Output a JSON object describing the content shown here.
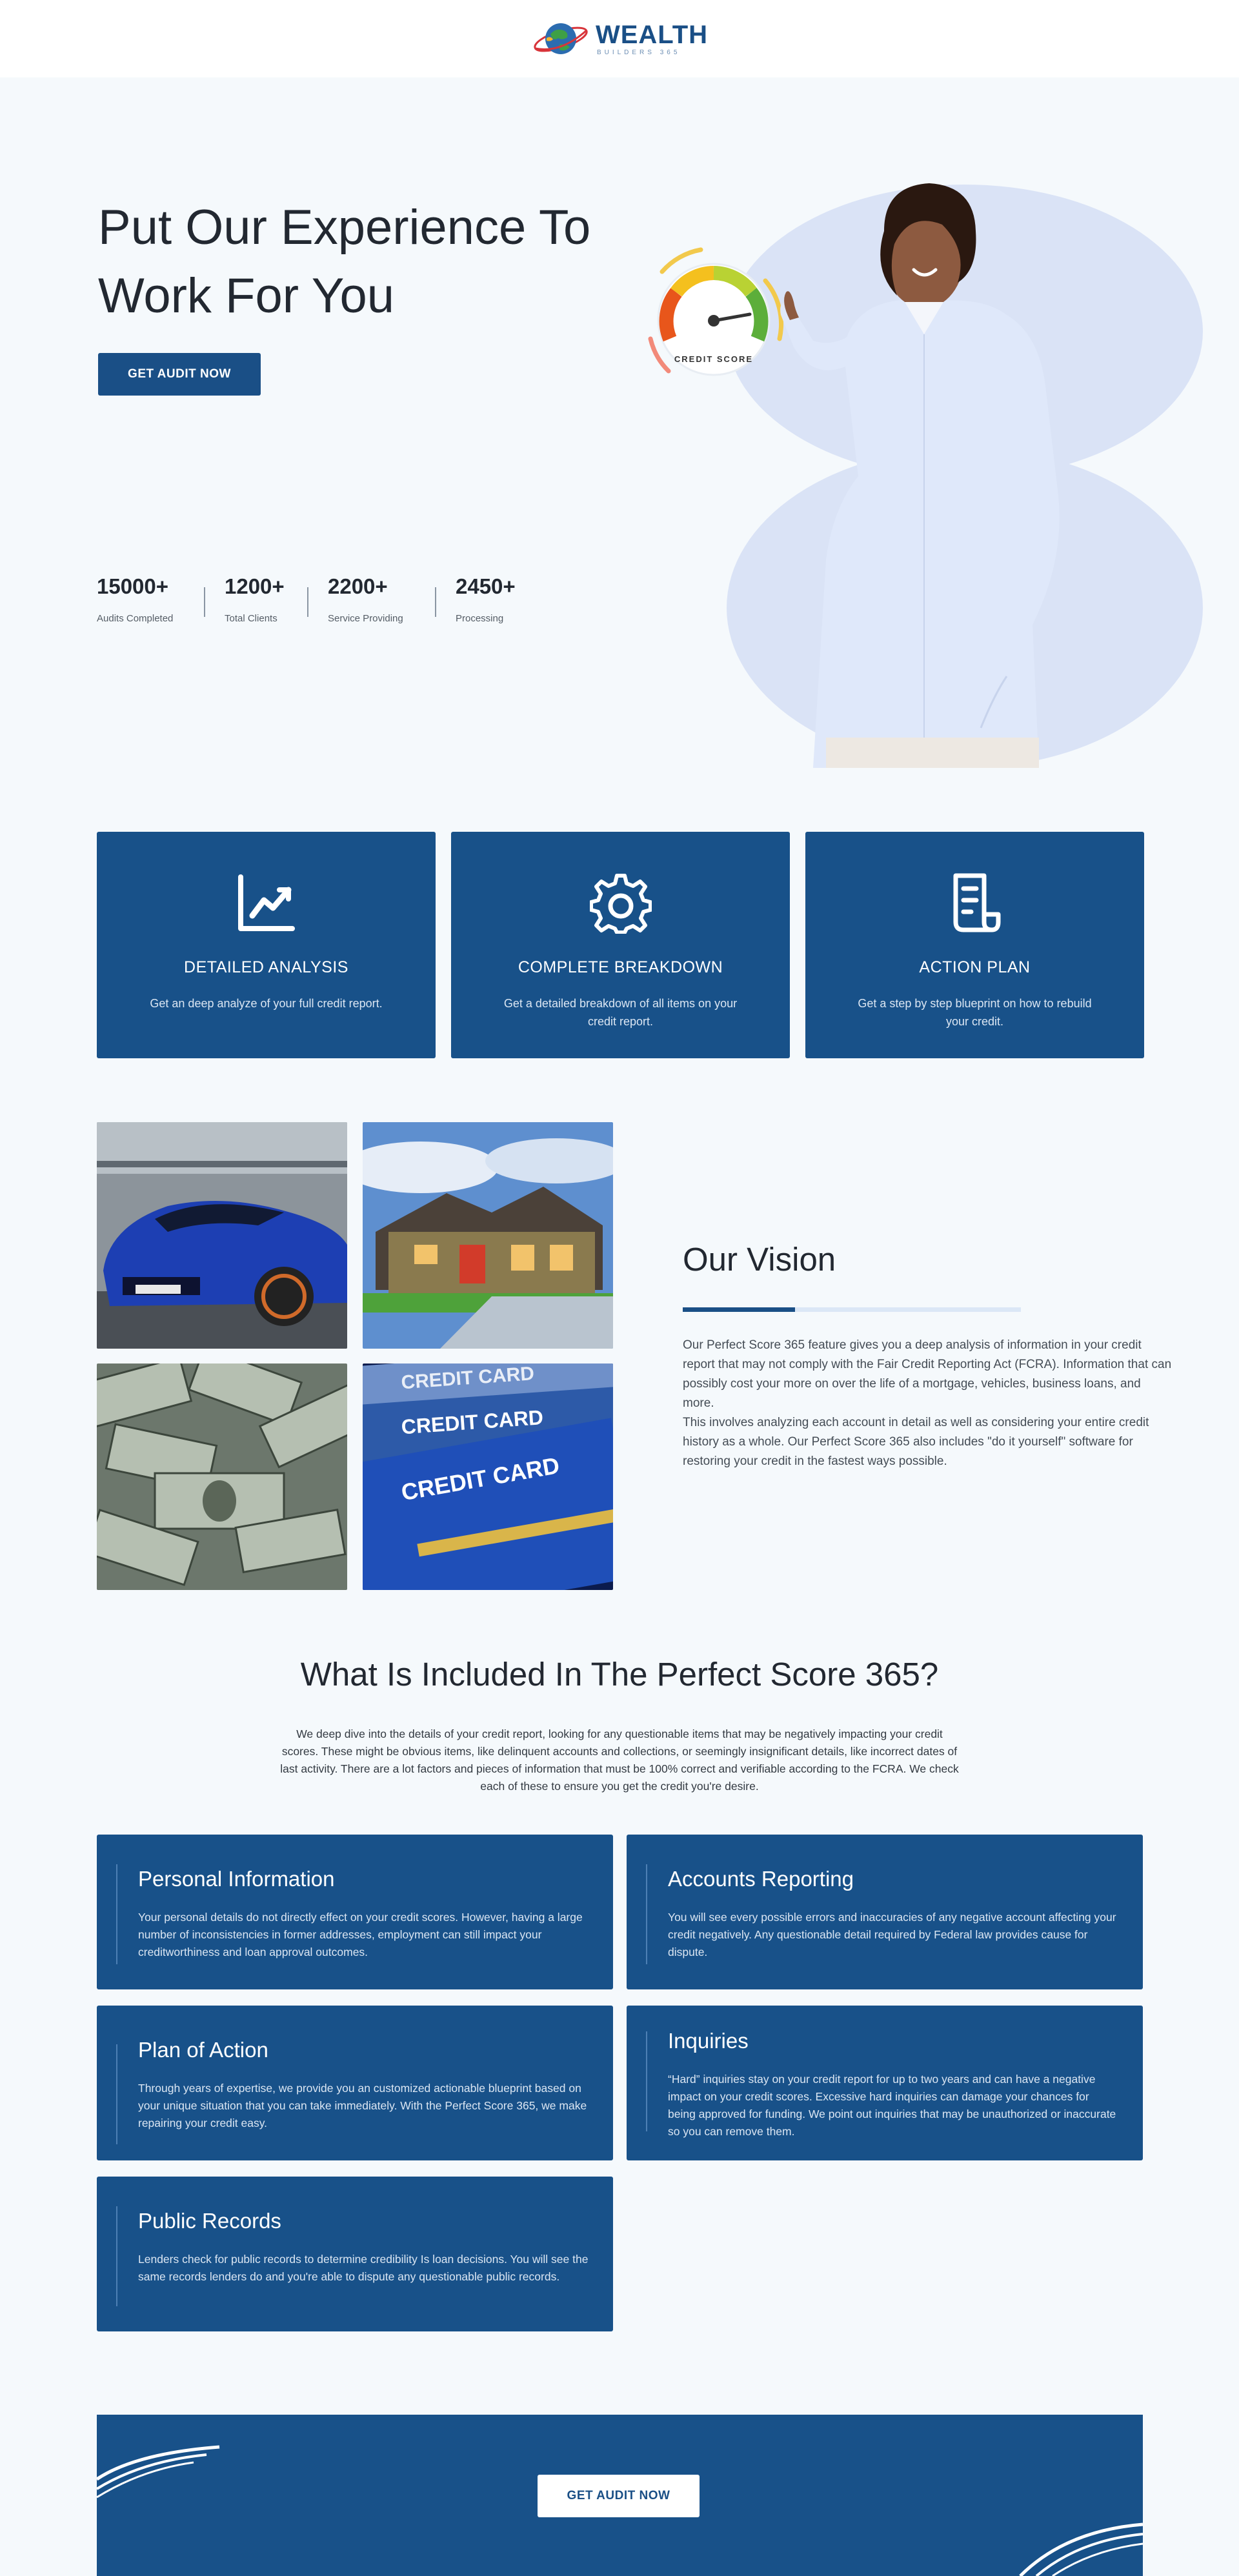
{
  "brand": {
    "name": "WEALTH",
    "tagline": "BUILDERS 365",
    "colors": {
      "primary": "#1a4f86",
      "card": "#185189",
      "background": "#f5f9fc"
    }
  },
  "hero": {
    "title_line1": "Put Our Experience To",
    "title_line2": "Work For You",
    "cta_label": "GET AUDIT NOW",
    "gauge_label": "CREDIT SCORE",
    "stats": [
      {
        "value": "15000+",
        "label": "Audits Completed"
      },
      {
        "value": "1200+",
        "label": "Total Clients"
      },
      {
        "value": "2200+",
        "label": "Service Providing"
      },
      {
        "value": "2450+",
        "label": "Processing"
      }
    ]
  },
  "features": [
    {
      "icon": "line-chart-icon",
      "title": "DETAILED ANALYSIS",
      "text": "Get an deep analyze of your full credit report."
    },
    {
      "icon": "gear-icon",
      "title": "COMPLETE BREAKDOWN",
      "text": "Get a detailed breakdown of all items on your credit report."
    },
    {
      "icon": "document-icon",
      "title": "ACTION PLAN",
      "text": "Get a step by step blueprint on how to rebuild your credit."
    }
  ],
  "vision": {
    "title": "Our Vision",
    "paragraph1": "Our Perfect Score 365 feature gives you a deep analysis of information in your credit report that may not comply with the Fair Credit Reporting Act (FCRA). Information that can possibly cost your more on over the life of a mortgage, vehicles, business loans, and more.",
    "paragraph2": "This involves analyzing each account in detail as well as considering your entire credit history as a whole. Our Perfect Score 365 also includes \"do it yourself\" software for restoring your credit in the fastest ways possible.",
    "photos": [
      {
        "name": "car-photo"
      },
      {
        "name": "house-photo"
      },
      {
        "name": "money-photo"
      },
      {
        "name": "credit-card-photo",
        "caption1": "CREDIT CARD",
        "caption2": "CREDIT CARD",
        "caption3": "CREDIT CARD"
      }
    ]
  },
  "included": {
    "title": "What Is Included In The Perfect Score 365?",
    "text": "We deep dive into the details of your credit report, looking for any questionable items that may be negatively impacting your credit scores. These might be obvious items, like delinquent accounts and collections, or seemingly insignificant details, like incorrect dates of last activity. There are a lot factors and pieces of information that must be 100% correct and verifiable according to the FCRA. We check each of these to ensure you get the credit you're desire.",
    "cards": [
      {
        "title": "Personal Information",
        "text": "Your personal details do not directly effect on your credit scores. However, having a large number of inconsistencies in former addresses, employment can still impact your creditworthiness and loan approval outcomes."
      },
      {
        "title": "Accounts Reporting",
        "text": "You will see every possible errors and inaccuracies of any negative account affecting your credit negatively. Any questionable detail required by Federal law provides cause for dispute."
      },
      {
        "title": "Plan of Action",
        "text": "Through years of expertise, we provide you an customized actionable blueprint based on your unique situation that you can take immediately. With the Perfect Score 365, we make repairing your credit easy."
      },
      {
        "title": "Inquiries",
        "text": "“Hard” inquiries stay on your credit report for up to two years and can have a negative impact on your credit scores. Excessive hard inquiries can damage your chances for being approved for funding. We point out inquiries that may be unauthorized or inaccurate so you can remove them."
      },
      {
        "title": "Public Records",
        "text": "Lenders check for public records to determine credibility Is loan decisions. You will see the same records lenders do and you're able to dispute any questionable public records."
      }
    ]
  },
  "cta": {
    "label": "GET AUDIT NOW"
  }
}
